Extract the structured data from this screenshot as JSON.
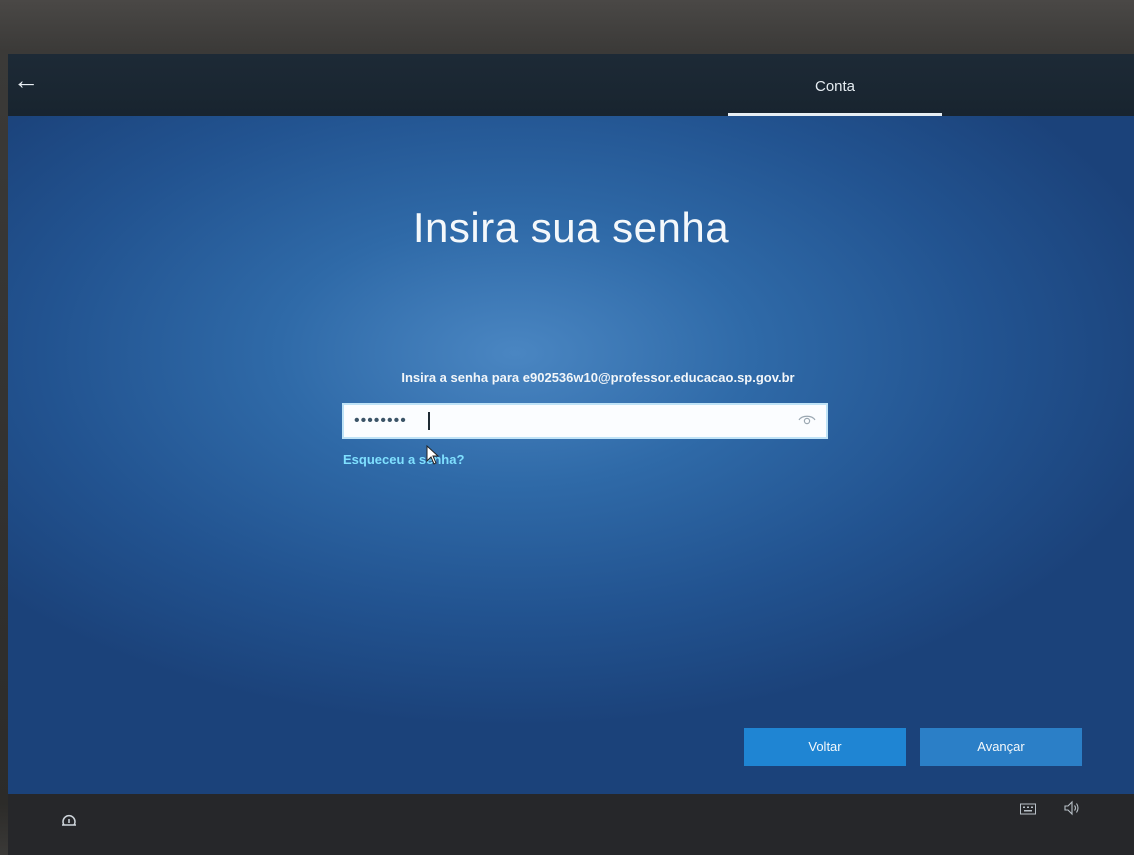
{
  "header": {
    "back_icon": "back-arrow-icon",
    "tab_label": "Conta"
  },
  "main": {
    "title": "Insira sua senha",
    "prompt": "Insira a senha para e902536w10@professor.educacao.sp.gov.br",
    "password_masked": "••••••••",
    "reveal_icon": "eye-icon",
    "forgot_link": "Esqueceu a senha?"
  },
  "buttons": {
    "back_label": "Voltar",
    "next_label": "Avançar"
  },
  "footer": {
    "ease_of_access_icon": "ease-of-access-icon",
    "keyboard_icon": "keyboard-icon",
    "volume_icon": "volume-icon"
  },
  "colors": {
    "background_blue": "#2f6aa8",
    "button_blue": "#1f85d3",
    "link_cyan": "#7fe0ff",
    "bar_dark": "#1d2a36"
  }
}
